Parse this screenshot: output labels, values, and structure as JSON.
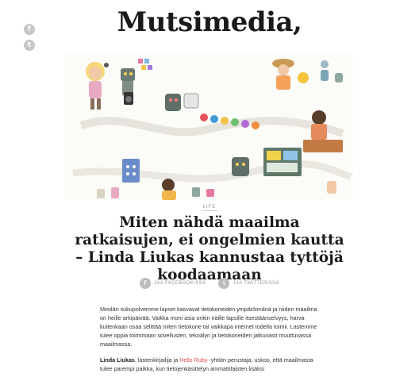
{
  "side_social": {
    "facebook_glyph": "f",
    "twitter_glyph": "t"
  },
  "logo": {
    "text": "Mutsimedia,"
  },
  "hero": {
    "description_icon": "illustration-image"
  },
  "article": {
    "category": "LIFE",
    "title": "Miten nähdä maailma ratkaisujen, ei ongelmien kautta – Linda Liukas kannustaa tyttöjä koodaamaan",
    "share": {
      "facebook_label": "JAA FACEBOOKISSA",
      "twitter_label": "JAA TWITTERISSÄ"
    },
    "paragraph1": "Meidän sukupolvemme lapset kasvavat tietokoneiden ympäröimänä ja niiden maailma on heille arkipäivää. Vaikka moni asia onkin näille lapsille itsestäänselvyys, harva kuitenkaan osaa selittää miten tietokone tai vaikkapa internet todella toimii. Lastemme tulee oppia toimimaan sovellusten, tekoälyn ja tietokoneiden jatkuvasti muuttuvassa maailmassa.",
    "paragraph2": {
      "name": "Linda Liukas",
      "text_before_link": ", lastenkirjailija ja ",
      "link": "Hello Ruby",
      "text_after_link": " -yhtiön perustaja, uskoo, että maailmasta tulee parempi paikka, kun tietojenkäsittelyn ammattilaisten lisäksi"
    }
  }
}
